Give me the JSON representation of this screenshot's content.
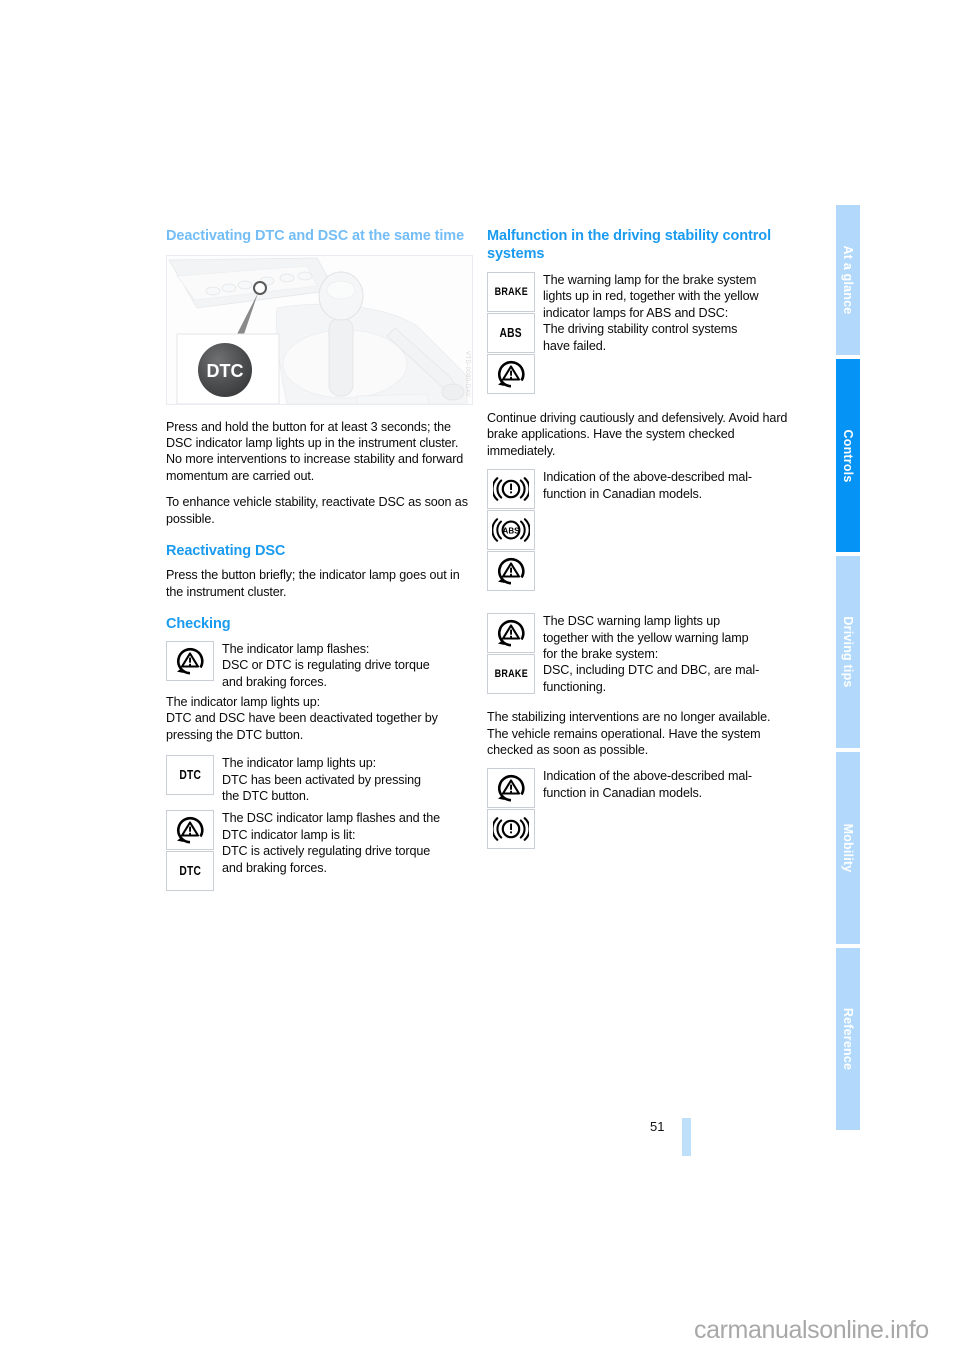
{
  "document": {
    "page_number": "51",
    "watermark": "carmanualsonline.info"
  },
  "tabs": [
    {
      "label": "At a glance",
      "active": false
    },
    {
      "label": "Controls",
      "active": true
    },
    {
      "label": "Driving tips",
      "active": false
    },
    {
      "label": "Mobility",
      "active": false
    },
    {
      "label": "Reference",
      "active": false
    }
  ],
  "left_column": {
    "heading_1": "Deactivating DTC and DSC at the same time",
    "figure": {
      "alt": "Center console with gear selector; inset shows the round DTC button",
      "button_label": "DTC",
      "code": "VTD-0080-DAV"
    },
    "para_1": "Press and hold the button for at least 3 seconds; the DSC indicator lamp lights up in the instrument cluster. No more interventions to increase stability and forward momentum are carried out.",
    "para_2": "To enhance vehicle stability, reactivate DSC as soon as possible.",
    "heading_2": "Reactivating DSC",
    "para_3": "Press the button briefly; the indicator lamp goes out in the instrument cluster.",
    "heading_3": "Checking",
    "block_1": {
      "icons": [
        "dsc-indicator-icon"
      ],
      "lines": [
        "The indicator lamp flashes:",
        "DSC or DTC is regulating drive torque",
        "and braking forces."
      ]
    },
    "para_4": "The indicator lamp lights up:\nDTC and DSC have been deactivated together by pressing the DTC button.",
    "block_2": {
      "icons": [
        "dtc-indicator-icon"
      ],
      "icon_text": "DTC",
      "lines": [
        "The indicator lamp lights up:",
        "DTC has been activated by pressing",
        "the DTC button."
      ]
    },
    "block_3": {
      "icons": [
        "dsc-indicator-icon",
        "dtc-indicator-icon"
      ],
      "icon_text": "DTC",
      "lines": [
        "The DSC indicator lamp flashes and the",
        "DTC indicator lamp is lit:",
        "DTC is actively regulating drive torque",
        "and braking forces."
      ]
    }
  },
  "right_column": {
    "heading_1": "Malfunction in the driving stability control systems",
    "block_1": {
      "icons": [
        "brake-warning-icon",
        "abs-warning-icon",
        "dsc-indicator-icon"
      ],
      "icon_text_1": "BRAKE",
      "icon_text_2": "ABS",
      "lines": [
        "The warning lamp for the brake system",
        "lights up in red, together with the yellow",
        "indicator lamps for ABS and DSC:",
        "The driving stability control systems",
        "have failed."
      ]
    },
    "para_1": "Continue driving cautiously and defensively. Avoid hard brake applications. Have the system checked immediately.",
    "block_2": {
      "icons": [
        "brake-canadian-icon",
        "abs-canadian-icon",
        "dsc-indicator-icon"
      ],
      "icon_text": "ABS",
      "lines": [
        "Indication of the above-described mal-",
        "function in Canadian models."
      ]
    },
    "block_3": {
      "icons": [
        "dsc-indicator-icon",
        "brake-warning-icon"
      ],
      "icon_text": "BRAKE",
      "lines": [
        "The DSC warning lamp lights up",
        "together with the yellow warning lamp",
        "for the brake system:",
        "DSC, including DTC and DBC, are mal-",
        "functioning."
      ]
    },
    "para_2": "The stabilizing interventions are no longer available. The vehicle remains operational. Have the system checked as soon as possible.",
    "block_4": {
      "icons": [
        "dsc-indicator-icon",
        "brake-canadian-icon"
      ],
      "lines": [
        "Indication of the above-described mal-",
        "function in Canadian models."
      ]
    }
  },
  "colors": {
    "heading_blue": "#74bdf5",
    "heading_blue_strong": "#1a9bf0",
    "tab_active": "#0593f5",
    "tab_inactive": "#b2d9fb",
    "page_rule": "#bfe0fb"
  }
}
